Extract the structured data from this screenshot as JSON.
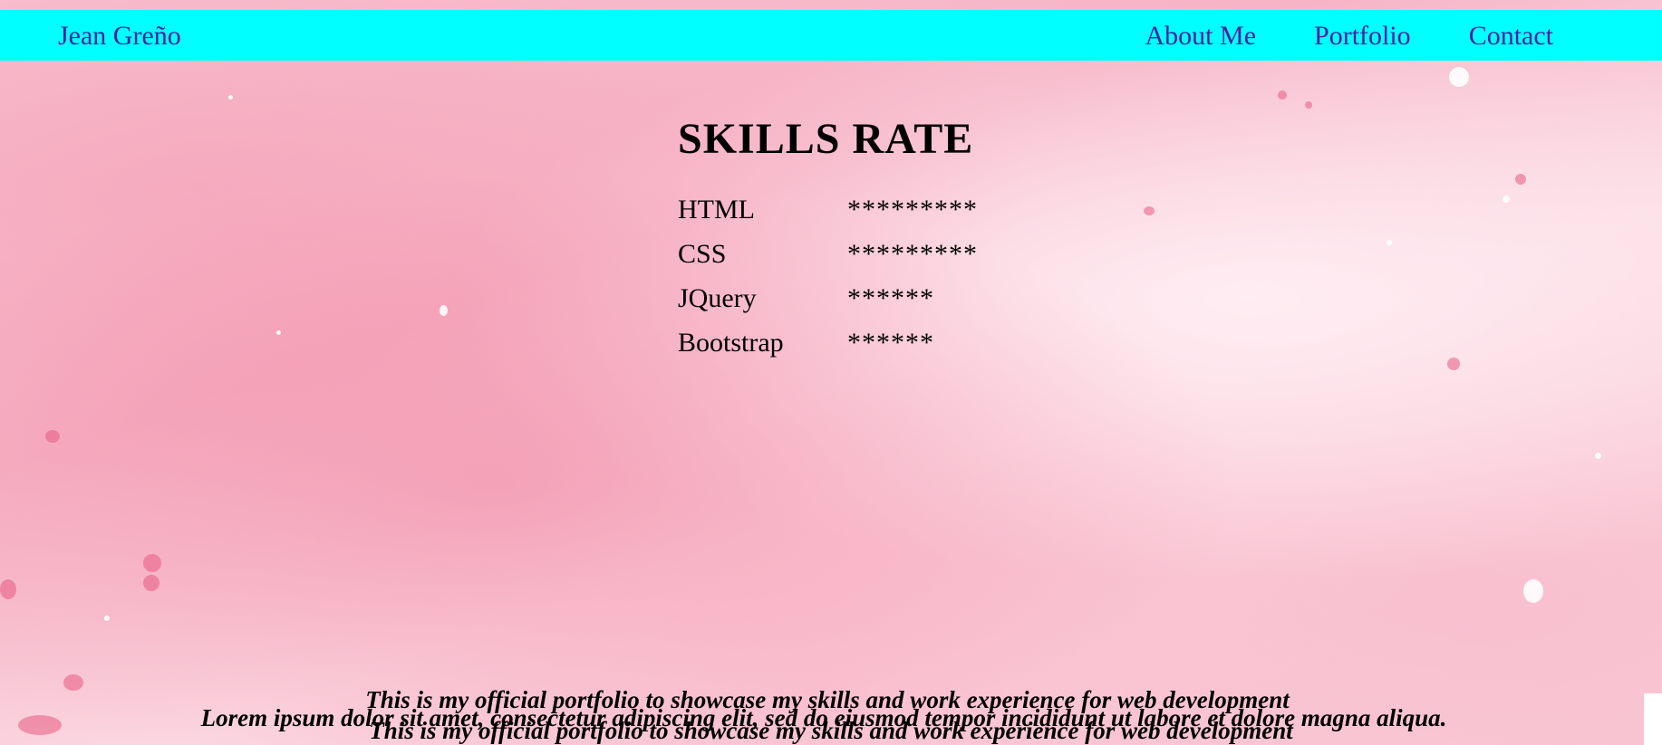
{
  "nav": {
    "brand": "Jean Greño",
    "links": [
      "About Me",
      "Portfolio",
      "Contact"
    ]
  },
  "skills": {
    "title": "SKILLS RATE",
    "rows": [
      {
        "name": "HTML",
        "stars": "*********"
      },
      {
        "name": "CSS",
        "stars": "*********"
      },
      {
        "name": "JQuery",
        "stars": "******"
      },
      {
        "name": "Bootstrap",
        "stars": "******"
      }
    ]
  },
  "footer": {
    "tagline": "This is my official portfolio to showcase my skills and work experience for web development",
    "lorem": "Lorem ipsum dolor sit amet, consectetur adipiscing elit, sed do eiusmod tempor incididunt ut labore et dolore magna aliqua."
  },
  "colors": {
    "navbar": "#00ffff",
    "nav_text": "#4b1f9e",
    "background": "#f8c3d1"
  }
}
